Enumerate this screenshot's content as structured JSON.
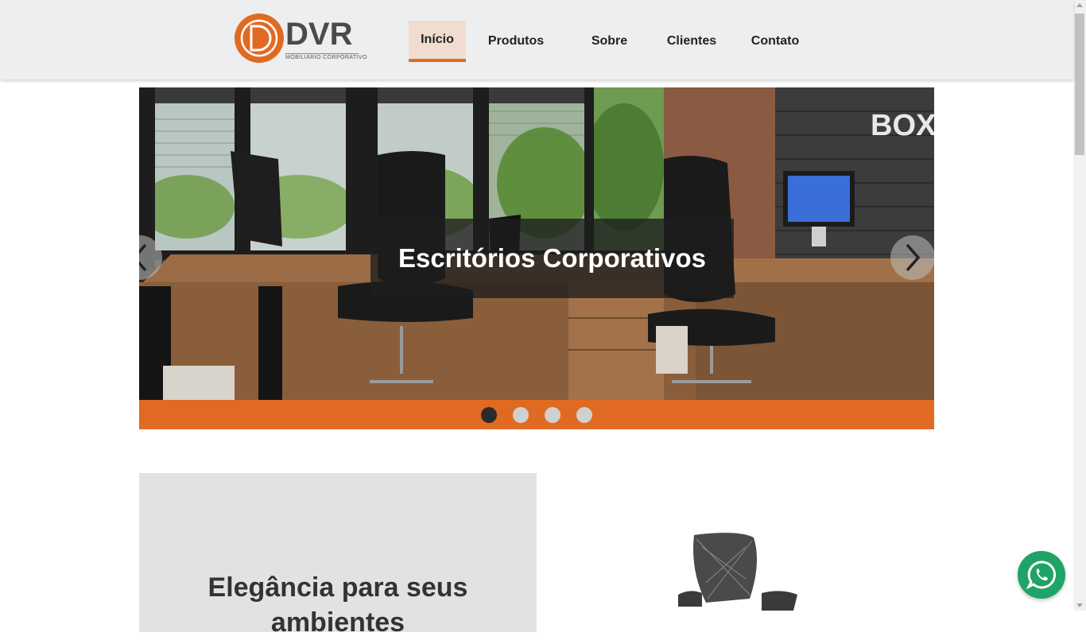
{
  "brand": {
    "name": "DVR",
    "tagline": "MOBILIÁRIO CORPORATIVO",
    "logo_letter": "D",
    "accent_color": "#e06a22"
  },
  "nav": {
    "items": [
      {
        "label": "Início",
        "active": true
      },
      {
        "label": "Produtos",
        "active": false
      },
      {
        "label": "Sobre",
        "active": false
      },
      {
        "label": "Clientes",
        "active": false
      },
      {
        "label": "Contato",
        "active": false
      }
    ]
  },
  "slider": {
    "caption": "Escritórios Corporativos",
    "sign_text": "BOX",
    "slide_count": 4,
    "active_index": 0,
    "prev_icon": "chevron-left-icon",
    "next_icon": "chevron-right-icon",
    "bar_color": "#e06a22"
  },
  "feature": {
    "title": "Elegância para seus ambientes"
  },
  "whatsapp": {
    "icon": "whatsapp-icon",
    "color": "#1fa366"
  }
}
